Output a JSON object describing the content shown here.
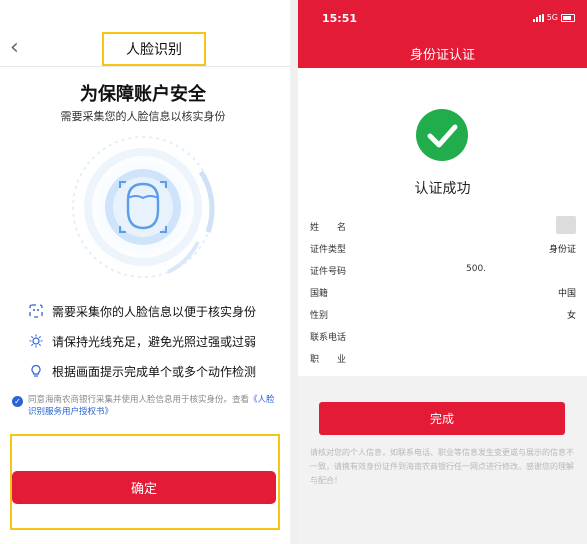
{
  "left": {
    "back_glyph": "‹",
    "nav_title": "人脸识别",
    "title": "为保障账户安全",
    "subtitle": "需要采集您的人脸信息以核实身份",
    "features": [
      {
        "icon": "face-scan-icon",
        "text": "需要采集你的人脸信息以便于核实身份"
      },
      {
        "icon": "sun-icon",
        "text": "请保持光线充足，避免光照过强或过弱"
      },
      {
        "icon": "lightbulb-icon",
        "text": "根据画面提示完成单个或多个动作检测"
      }
    ],
    "agreement": {
      "checked": true,
      "text": "同意海南农商银行采集并使用人脸信息用于核实身份。查看",
      "link": "《人脸识别服务用户授权书》"
    },
    "confirm_label": "确定",
    "colors": {
      "accent": "#e31b37",
      "highlight": "#f5c518",
      "link": "#2b63d6"
    }
  },
  "right": {
    "time": "15:51",
    "network": "5G",
    "title": "身份证认证",
    "success_text": "认证成功",
    "info_rows": [
      {
        "label": "姓　　名",
        "value": ""
      },
      {
        "label": "证件类型",
        "value": "身份证"
      },
      {
        "label": "证件号码",
        "value": "500."
      },
      {
        "label": "国籍",
        "value": "中国"
      },
      {
        "label": "性别",
        "value": "女"
      },
      {
        "label": "联系电话",
        "value": ""
      },
      {
        "label": "职　　业",
        "value": ""
      }
    ],
    "done_label": "完成",
    "notice": "请核对您的个人信息，如联系电话、职业等信息发生变更或与展示的信息不一致，请携有效身份证件到海南农商银行任一网点进行修改。感谢您的理解与配合！",
    "colors": {
      "header": "#e31b37",
      "success": "#22ad4d"
    }
  }
}
